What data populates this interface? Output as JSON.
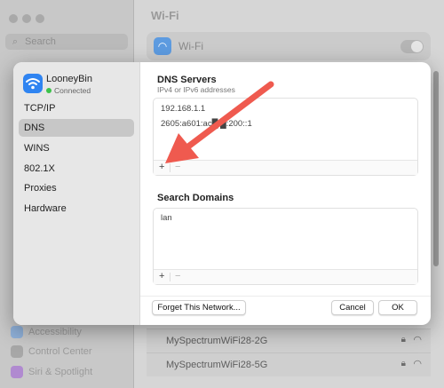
{
  "background": {
    "search_placeholder": "Search",
    "title": "Wi-Fi",
    "wifi_row_label": "Wi-Fi",
    "sidebar_items": [
      "Accessibility",
      "Control Center",
      "Siri & Spotlight"
    ],
    "networks": [
      {
        "name": "MySpectrumWiFi28-2G"
      },
      {
        "name": "MySpectrumWiFi28-5G"
      }
    ]
  },
  "sheet": {
    "network_name": "LooneyBin",
    "network_status": "Connected",
    "nav": [
      "TCP/IP",
      "DNS",
      "WINS",
      "802.1X",
      "Proxies",
      "Hardware"
    ],
    "selected_nav": "DNS",
    "dns": {
      "title": "DNS Servers",
      "subtitle": "IPv4 or IPv6 addresses",
      "servers": [
        "192.168.1.1",
        "2605:a601:ac█ █:200::1"
      ],
      "add": "+",
      "remove": "−"
    },
    "search_domains": {
      "title": "Search Domains",
      "entries": [
        "lan"
      ],
      "add": "+",
      "remove": "−"
    },
    "buttons": {
      "forget": "Forget This Network...",
      "cancel": "Cancel",
      "ok": "OK"
    }
  },
  "colors": {
    "accent": "#2f84f1",
    "annotation_arrow": "#ef5a4f",
    "connected_dot": "#3cc24a"
  }
}
